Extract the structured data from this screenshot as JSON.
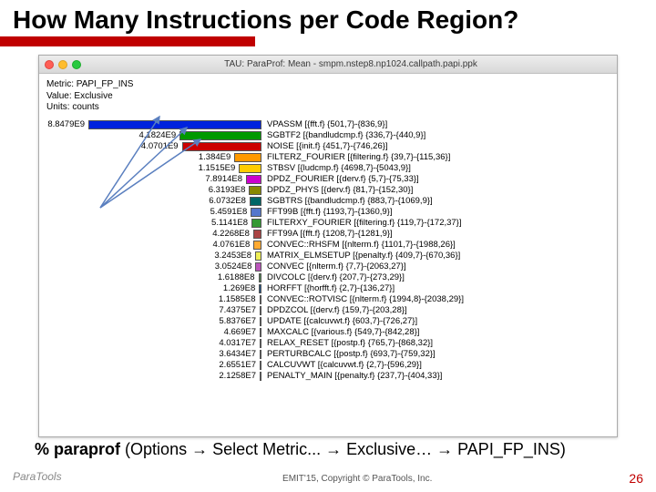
{
  "slide": {
    "title": "How Many Instructions per Code Region?",
    "caption_cmd": "% paraprof",
    "caption_rest": "(Options → Select Metric... → Exclusive… → PAPI_FP_INS)",
    "copyright": "EMIT'15, Copyright © ParaTools, Inc.",
    "page": "26",
    "logo": "ParaTools"
  },
  "window": {
    "title": "TAU: ParaProf: Mean - smpm.nstep8.np1024.callpath.papi.ppk",
    "meta": {
      "metric_lbl": "Metric:",
      "metric_val": "PAPI_FP_INS",
      "value_lbl": "Value:",
      "value_val": "Exclusive",
      "units_lbl": "Units:",
      "units_val": "counts"
    }
  },
  "chart_data": {
    "type": "bar",
    "xlabel": "",
    "ylabel": "",
    "title": "",
    "series": [
      {
        "value": "8.8479E9",
        "label": "VPASSM [{fft.f} {501,7}-{836,9}]",
        "color": "#0022dd"
      },
      {
        "value": "4.1824E9",
        "label": "SGBTF2 [{bandludcmp.f} {336,7}-{440,9}]",
        "color": "#009900"
      },
      {
        "value": "4.0701E9",
        "label": "NOISE [{init.f} {451,7}-{746,26}]",
        "color": "#cc0000"
      },
      {
        "value": "1.384E9",
        "label": "FILTERZ_FOURIER [{filtering.f} {39,7}-{115,36}]",
        "color": "#ff9900"
      },
      {
        "value": "1.1515E9",
        "label": "STBSV [{ludcmp.f} {4698,7}-{5043,9}]",
        "color": "#ffcc00"
      },
      {
        "value": "7.8914E8",
        "label": "DPDZ_FOURIER [{derv.f} {5,7}-{75,33}]",
        "color": "#cc00cc"
      },
      {
        "value": "6.3193E8",
        "label": "DPDZ_PHYS [{derv.f} {81,7}-{152,30}]",
        "color": "#888800"
      },
      {
        "value": "6.0732E8",
        "label": "SGBTRS [{bandludcmp.f} {883,7}-{1069,9}]",
        "color": "#006666"
      },
      {
        "value": "5.4591E8",
        "label": "FFT99B [{fft.f} {1193,7}-{1360,9}]",
        "color": "#5577cc"
      },
      {
        "value": "5.1141E8",
        "label": "FILTERXY_FOURIER [{filtering.f} {119,7}-{172,37}]",
        "color": "#339933"
      },
      {
        "value": "4.2268E8",
        "label": "FFT99A [{fft.f} {1208,7}-{1281,9}]",
        "color": "#aa4444"
      },
      {
        "value": "4.0761E8",
        "label": "CONVEC::RHSFM [{nlterm.f} {1101,7}-{1988,26}]",
        "color": "#ffaa33"
      },
      {
        "value": "3.2453E8",
        "label": "MATRIX_ELMSETUP [{penalty.f} {409,7}-{670,36}]",
        "color": "#eeee55"
      },
      {
        "value": "3.0524E8",
        "label": "CONVEC [{nlterm.f} {7,7}-{2063,27}]",
        "color": "#bb55bb"
      },
      {
        "value": "1.6188E8",
        "label": "DIVCOLC [{derv.f} {207,7}-{273,29}]",
        "color": "#558855"
      },
      {
        "value": "1.269E8",
        "label": "HORFFT [{horfft.f} {2,7}-{136,27}]",
        "color": "#225588"
      },
      {
        "value": "1.1585E8",
        "label": "CONVEC::ROTVISC [{nlterm.f} {1994,8}-{2038,29}]",
        "color": "#55aa55"
      },
      {
        "value": "7.4375E7",
        "label": "DPDZCOL [{derv.f} {159,7}-{203,28}]",
        "color": "#bb6633"
      },
      {
        "value": "5.8376E7",
        "label": "UPDATE [{calcuvwt.f} {603,7}-{726,27}]",
        "color": "#ccbb44"
      },
      {
        "value": "4.669E7",
        "label": "MAXCALC [{various.f} {549,7}-{842,28}]",
        "color": "#aa77aa"
      },
      {
        "value": "4.0317E7",
        "label": "RELAX_RESET [{postp.f} {765,7}-{868,32}]",
        "color": "#777733"
      },
      {
        "value": "3.6434E7",
        "label": "PERTURBCALC [{postp.f} {693,7}-{759,32}]",
        "color": "#336666"
      },
      {
        "value": "2.6551E7",
        "label": "CALCUVWT [{calcuvwt.f} {2,7}-{596,29}]",
        "color": "#6688bb"
      },
      {
        "value": "2.1258E7",
        "label": "PENALTY_MAIN [{penalty.f} {237,7}-{404,33}]",
        "color": "#55aa77"
      }
    ]
  }
}
